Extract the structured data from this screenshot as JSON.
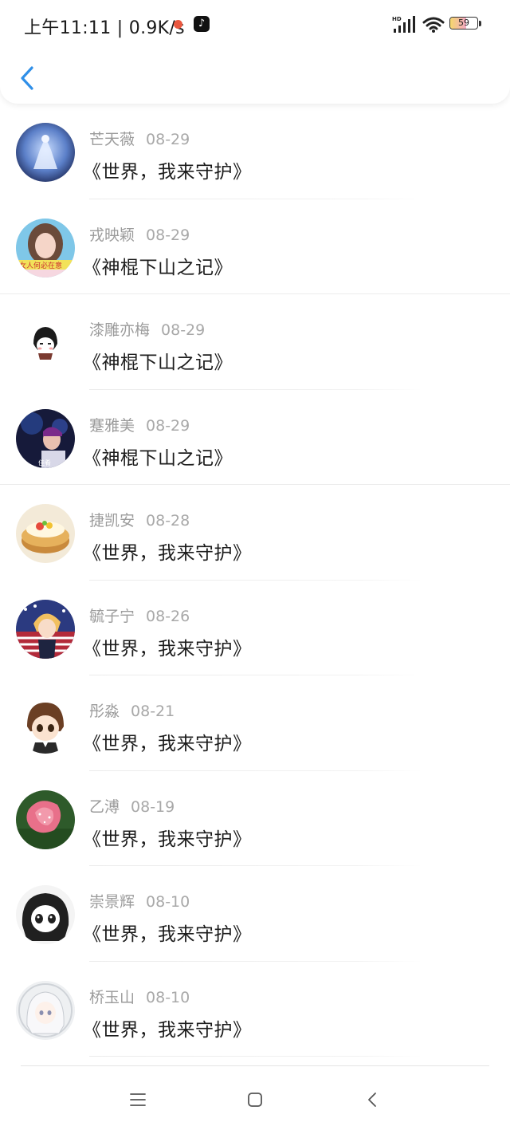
{
  "status_bar": {
    "time_speed": "上午11:11 | 0.9K/s",
    "battery_level": "59",
    "battery_fraction": 0.59,
    "icons": [
      "recording-dot-icon",
      "tiktok-icon",
      "hd-signal-icon",
      "wifi-icon",
      "battery-icon"
    ]
  },
  "header": {
    "back_icon": "chevron-left-icon",
    "accent_color": "#2f8fe8"
  },
  "items": [
    {
      "name": "芒天薇",
      "date": "08-29",
      "title": "《世界，我来守护》",
      "avatar": "avatar-blue-figure"
    },
    {
      "name": "戎映颖",
      "date": "08-29",
      "title": "《神棍下山之记》",
      "avatar": "avatar-girl-photo"
    },
    {
      "name": "漆雕亦梅",
      "date": "08-29",
      "title": "《神棍下山之记》",
      "avatar": "avatar-cartoon-girl"
    },
    {
      "name": "蹇雅美",
      "date": "08-29",
      "title": "《神棍下山之记》",
      "avatar": "avatar-stage-performer"
    },
    {
      "name": "捷凯安",
      "date": "08-28",
      "title": "《世界，我来守护》",
      "avatar": "avatar-cake"
    },
    {
      "name": "毓子宁",
      "date": "08-26",
      "title": "《世界，我来守护》",
      "avatar": "avatar-anime-boy-flag"
    },
    {
      "name": "彤淼",
      "date": "08-21",
      "title": "《世界，我来守护》",
      "avatar": "avatar-anime-chibi"
    },
    {
      "name": "乙溥",
      "date": "08-19",
      "title": "《世界，我来守护》",
      "avatar": "avatar-pink-rose"
    },
    {
      "name": "崇景辉",
      "date": "08-10",
      "title": "《世界，我来守护》",
      "avatar": "avatar-manga-girl"
    },
    {
      "name": "桥玉山",
      "date": "08-10",
      "title": "《世界，我来守护》",
      "avatar": "avatar-white-hair-girl"
    }
  ],
  "nav": {
    "icons": [
      "menu-icon",
      "home-square-icon",
      "back-triangle-icon"
    ]
  }
}
